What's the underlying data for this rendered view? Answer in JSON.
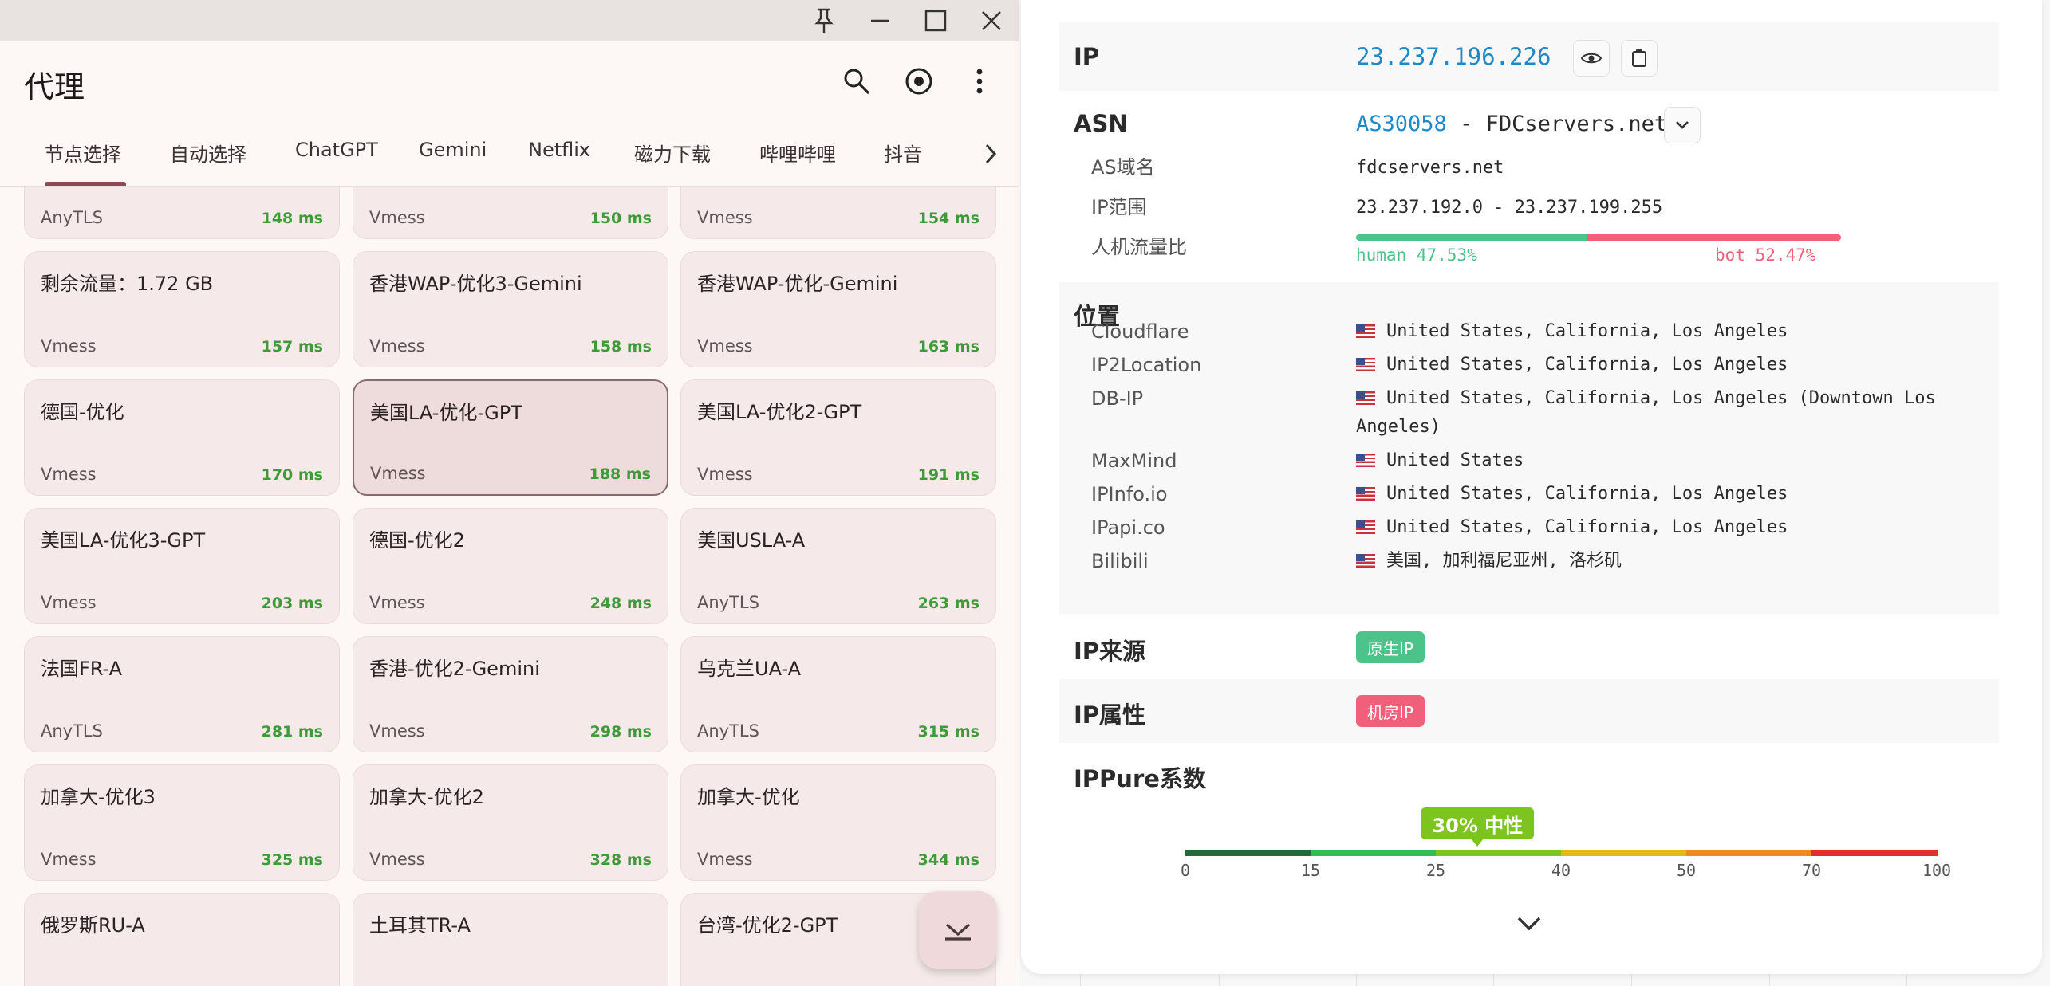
{
  "app": {
    "title": "代理",
    "window_controls": [
      "pin-icon",
      "minimize-icon",
      "maximize-icon",
      "close-icon"
    ],
    "toolbar_icons": [
      "search-icon",
      "target-icon",
      "more-vert-icon"
    ],
    "tabs": [
      "节点选择",
      "自动选择",
      "ChatGPT",
      "Gemini",
      "Netflix",
      "磁力下载",
      "哔哩哔哩",
      "抖音"
    ],
    "active_tab": "节点选择",
    "accent": "#8c4a52",
    "delay_color": "#3f9a3a",
    "nodes": [
      {
        "name": "",
        "type": "AnyTLS",
        "delay": "148 ms"
      },
      {
        "name": "",
        "type": "Vmess",
        "delay": "150 ms"
      },
      {
        "name": "",
        "type": "Vmess",
        "delay": "154 ms"
      },
      {
        "name": "剩余流量：1.72 GB",
        "type": "Vmess",
        "delay": "157 ms"
      },
      {
        "name": "香港WAP-优化3-Gemini",
        "type": "Vmess",
        "delay": "158 ms"
      },
      {
        "name": "香港WAP-优化-Gemini",
        "type": "Vmess",
        "delay": "163 ms"
      },
      {
        "name": "德国-优化",
        "type": "Vmess",
        "delay": "170 ms"
      },
      {
        "name": "美国LA-优化-GPT",
        "type": "Vmess",
        "delay": "188 ms",
        "selected": true
      },
      {
        "name": "美国LA-优化2-GPT",
        "type": "Vmess",
        "delay": "191 ms"
      },
      {
        "name": "美国LA-优化3-GPT",
        "type": "Vmess",
        "delay": "203 ms"
      },
      {
        "name": "德国-优化2",
        "type": "Vmess",
        "delay": "248 ms"
      },
      {
        "name": "美国USLA-A",
        "type": "AnyTLS",
        "delay": "263 ms"
      },
      {
        "name": "法国FR-A",
        "type": "AnyTLS",
        "delay": "281 ms"
      },
      {
        "name": "香港-优化2-Gemini",
        "type": "Vmess",
        "delay": "298 ms"
      },
      {
        "name": "乌克兰UA-A",
        "type": "AnyTLS",
        "delay": "315 ms"
      },
      {
        "name": "加拿大-优化3",
        "type": "Vmess",
        "delay": "325 ms"
      },
      {
        "name": "加拿大-优化2",
        "type": "Vmess",
        "delay": "328 ms"
      },
      {
        "name": "加拿大-优化",
        "type": "Vmess",
        "delay": "344 ms"
      },
      {
        "name": "俄罗斯RU-A",
        "type": "",
        "delay": ""
      },
      {
        "name": "土耳其TR-A",
        "type": "",
        "delay": ""
      },
      {
        "name": "台湾-优化2-GPT",
        "type": "",
        "delay": ""
      }
    ],
    "fab_icon": "collapse-down-icon"
  },
  "ipinfo": {
    "ip_label": "IP",
    "ip_value": "23.237.196.226",
    "asn_label": "ASN",
    "asn_number": "AS30058",
    "asn_rest": " - FDCservers.net",
    "as_domain_label": "AS域名",
    "as_domain_value": "fdcservers.net",
    "ip_range_label": "IP范围",
    "ip_range_value": "23.237.192.0 - 23.237.199.255",
    "traffic_label": "人机流量比",
    "human_text": "human 47.53%",
    "bot_text": "bot 52.47%",
    "human_ratio": 0.4753,
    "human_color": "#4cc38a",
    "bot_color": "#f0607a",
    "location_label": "位置",
    "locations": [
      {
        "source": "Cloudflare",
        "value": "United States, California, Los Angeles"
      },
      {
        "source": "IP2Location",
        "value": "United States, California, Los Angeles"
      },
      {
        "source": "DB-IP",
        "value": "United States, California, Los Angeles (Downtown Los Angeles)"
      },
      {
        "source": "MaxMind",
        "value": "United States"
      },
      {
        "source": "IPInfo.io",
        "value": "United States, California, Los Angeles"
      },
      {
        "source": "IPapi.co",
        "value": "United States, California, Los Angeles"
      },
      {
        "source": "Bilibili",
        "value": "美国, 加利福尼亚州, 洛杉矶"
      }
    ],
    "source_label": "IP来源",
    "source_tag": "原生IP",
    "source_tag_color": "#4cc38a",
    "attr_label": "IP属性",
    "attr_tag": "机房IP",
    "attr_tag_color": "#f0607a",
    "pure_label": "IPPure系数",
    "pure_badge": "30% 中性",
    "pure_value": 30,
    "pure_badge_color": "#7ec41e",
    "gauge_ticks": [
      "0",
      "15",
      "25",
      "40",
      "50",
      "70",
      "100"
    ],
    "gauge_colors": [
      "#1e6b3a",
      "#2ebd58",
      "#7ec41e",
      "#e8b81a",
      "#f08a1e",
      "#e03028"
    ]
  }
}
